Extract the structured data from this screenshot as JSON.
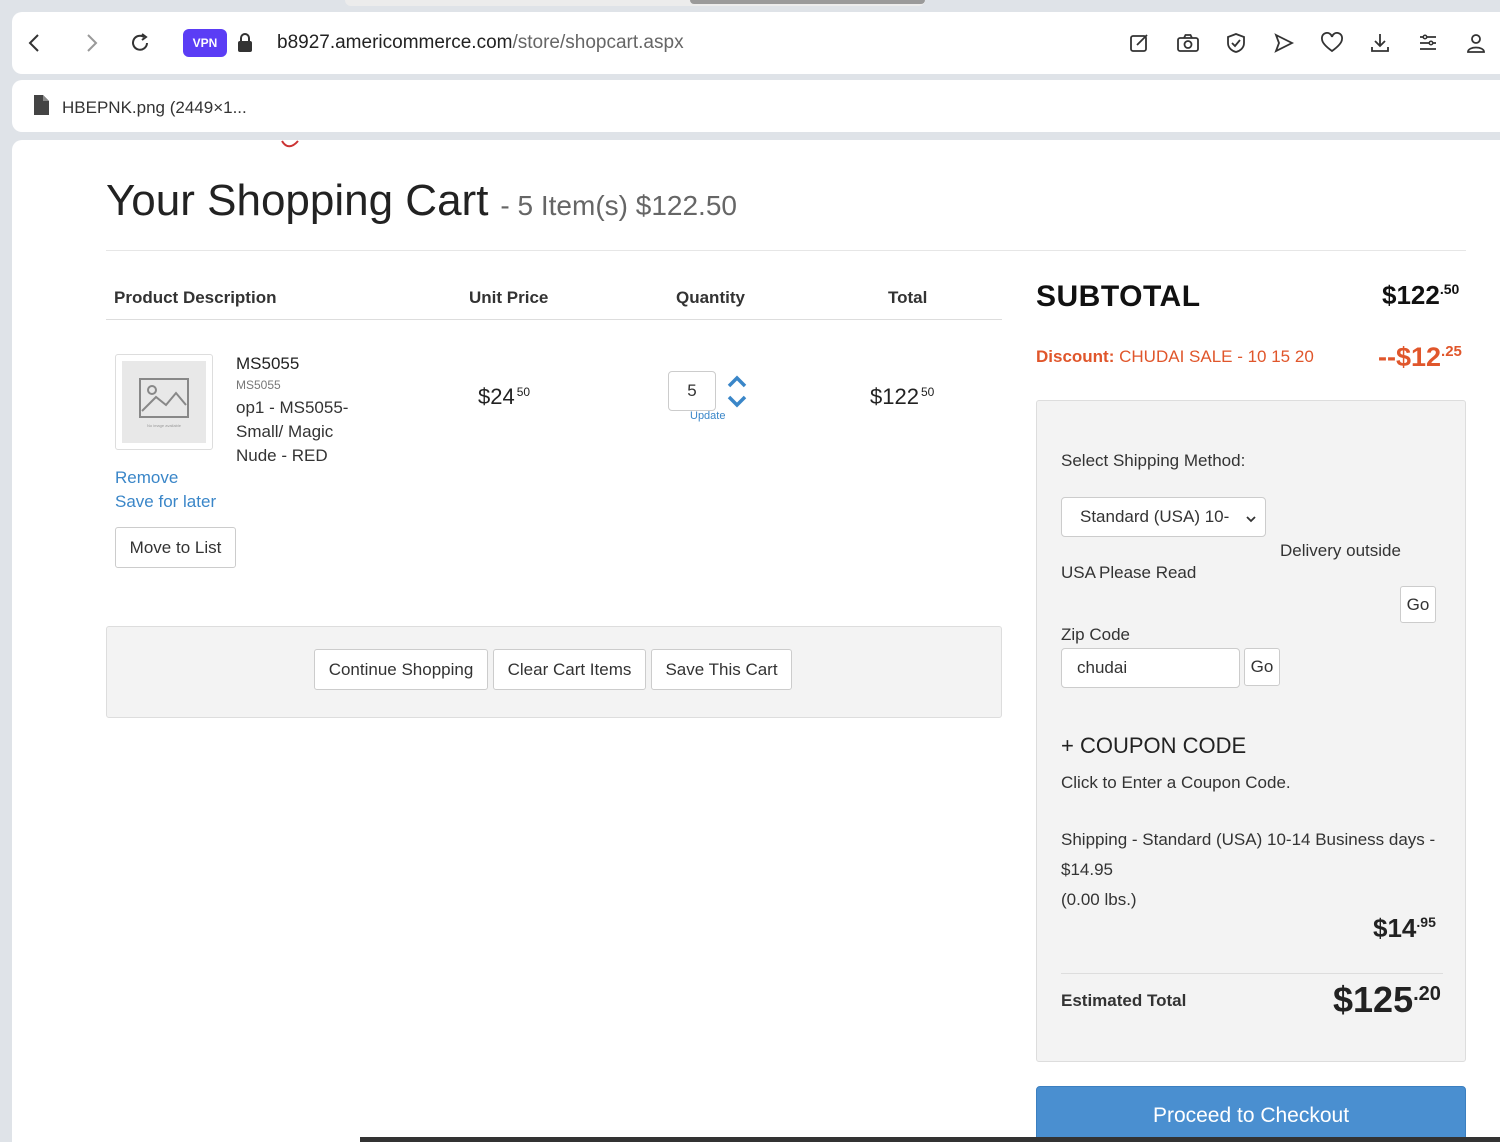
{
  "browser": {
    "vpn_label": "VPN",
    "url_host": "b8927.americommerce.com",
    "url_path": "/store/shopcart.aspx",
    "bookmark_label": "HBEPNK.png (2449×1..."
  },
  "page": {
    "title": "Your Shopping Cart",
    "title_summary": "- 5 Item(s) $122.50"
  },
  "table": {
    "headers": [
      "Product Description",
      "Unit Price",
      "Quantity",
      "Total"
    ]
  },
  "item": {
    "name": "MS5055",
    "sku": "MS5055",
    "description": "op1 - MS5055- Small/ Magic Nude - RED",
    "image_placeholder": "No image available",
    "unit_price_main": "$24",
    "unit_price_cents": "50",
    "quantity": "5",
    "update_label": "Update",
    "total_main": "$122",
    "total_cents": "50",
    "remove_label": "Remove",
    "save_later_label": "Save for later",
    "move_to_list_label": "Move to List"
  },
  "actions": {
    "continue_label": "Continue Shopping",
    "clear_label": "Clear Cart Items",
    "save_label": "Save This Cart"
  },
  "summary": {
    "subtotal_label": "SUBTOTAL",
    "subtotal_main": "$122",
    "subtotal_cents": ".50",
    "discount_prefix": "Discount:",
    "discount_name": "CHUDAI SALE - 10 15 20",
    "discount_main": "--$12",
    "discount_cents": ".25",
    "shipping_method_label": "Select Shipping Method:",
    "shipping_select_value": "Standard (USA) 10-",
    "delivery_outside": "Delivery outside",
    "usa_label": "USA",
    "please_read": "Please Read",
    "go_label": "Go",
    "zip_label": "Zip Code",
    "zip_value": "chudai",
    "zip_go_label": "Go",
    "coupon_title": "+ COUPON CODE",
    "coupon_hint": "Click to Enter a Coupon Code.",
    "shipping_line1": "Shipping - Standard (USA) 10-14 Business days -",
    "shipping_line2": "$14.95",
    "shipping_line3": "(0.00 lbs.)",
    "shipping_main": "$14",
    "shipping_cents": ".95",
    "estimated_label": "Estimated Total",
    "estimated_main": "$125",
    "estimated_cents": ".20",
    "checkout_label": "Proceed to Checkout"
  },
  "colors": {
    "link": "#3a86c8",
    "discount": "#e0562b",
    "checkout": "#4a8fd0",
    "vpn": "#5b3df5"
  }
}
